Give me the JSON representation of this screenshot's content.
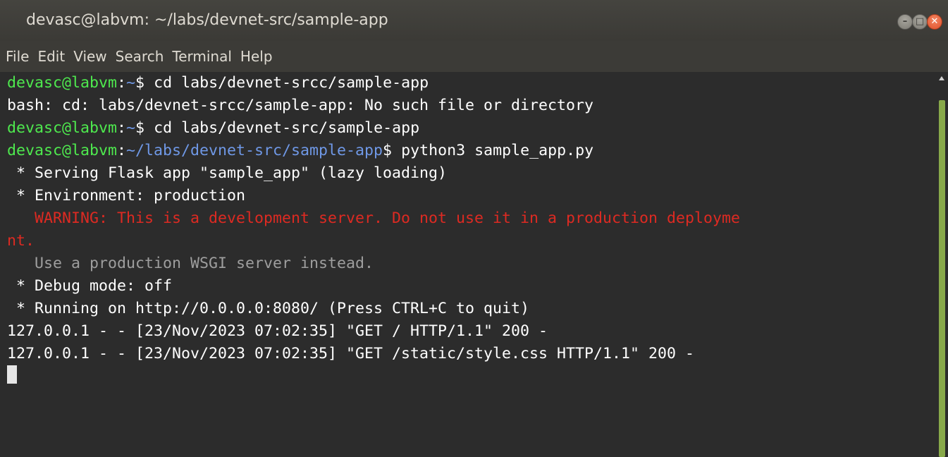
{
  "window": {
    "title": "devasc@labvm: ~/labs/devnet-src/sample-app",
    "controls": {
      "minimize": "–",
      "maximize": "□",
      "close": "✕"
    }
  },
  "menubar": {
    "items": [
      "File",
      "Edit",
      "View",
      "Search",
      "Terminal",
      "Help"
    ]
  },
  "terminal": {
    "prompt_user": "devasc@labvm",
    "lines": [
      {
        "prompt_user": "devasc@labvm",
        "prompt_path": "~",
        "command": " cd labs/devnet-srcc/sample-app"
      },
      {
        "output": "bash: cd: labs/devnet-srcc/sample-app: No such file or directory"
      },
      {
        "prompt_user": "devasc@labvm",
        "prompt_path": "~",
        "command": " cd labs/devnet-src/sample-app"
      },
      {
        "prompt_user": "devasc@labvm",
        "prompt_path": "~/labs/devnet-src/sample-app",
        "command": " python3 sample_app.py"
      },
      {
        "output": " * Serving Flask app \"sample_app\" (lazy loading)"
      },
      {
        "output": " * Environment: production"
      },
      {
        "warning": "   WARNING: This is a development server. Do not use it in a production deployme"
      },
      {
        "warning": "nt."
      },
      {
        "dim": "   Use a production WSGI server instead."
      },
      {
        "output": " * Debug mode: off"
      },
      {
        "output": " * Running on http://0.0.0.0:8080/ (Press CTRL+C to quit)"
      },
      {
        "output": "127.0.0.1 - - [23/Nov/2023 07:02:35] \"GET / HTTP/1.1\" 200 -"
      },
      {
        "output": "127.0.0.1 - - [23/Nov/2023 07:02:35] \"GET /static/style.css HTTP/1.1\" 200 -"
      }
    ],
    "colors": {
      "prompt_user": "#4ee94e",
      "prompt_path": "#6f98e6",
      "warning": "#dd2a22",
      "dim": "#9e9e9e",
      "background": "#2c2c2c"
    }
  }
}
